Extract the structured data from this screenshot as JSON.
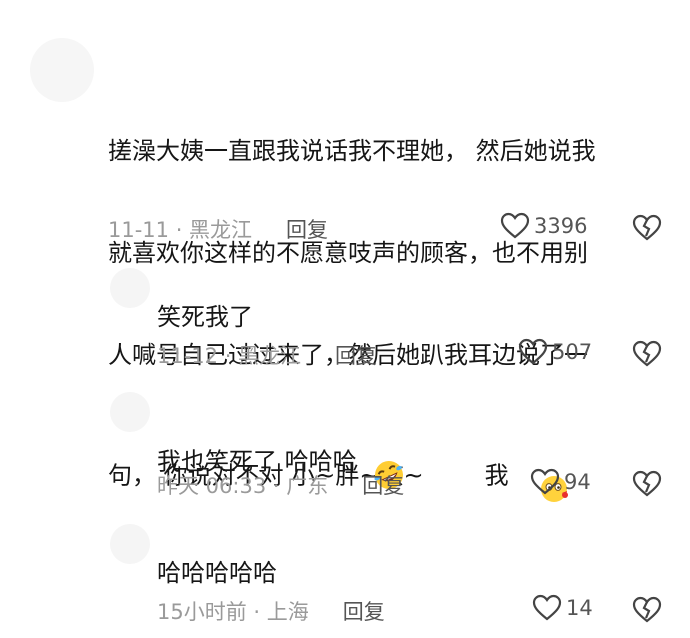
{
  "comments": [
    {
      "text_line1": "搓澡大姨一直跟我说话我不理她， 然后她说我",
      "text_line2": "就喜欢你这样的不愿意吱声的顾客，也不用别",
      "text_line3": "人喊号自己过过来了，然后她趴我耳边说了一",
      "text_line4": "句， 你说对不对 小~胖~孩~        我",
      "emoji": "blush-kiss-emoji",
      "meta": "11-11 · 黑龙江",
      "reply_label": "回复",
      "likes": "3396"
    },
    {
      "text": "笑死我了",
      "meta": "11-12 · 黑龙江",
      "reply_label": "回复",
      "likes": "507"
    },
    {
      "text": "我也笑死了 哈哈哈",
      "emoji": "rofl-emoji",
      "meta": "昨天 06:33 · 广东",
      "reply_label": "回复",
      "likes": "94"
    },
    {
      "text": "哈哈哈哈哈",
      "meta": "15小时前 · 上海",
      "reply_label": "回复",
      "likes": "14"
    }
  ],
  "colors": {
    "text": "#161616",
    "meta": "#9a9a9a",
    "action": "#555555"
  }
}
